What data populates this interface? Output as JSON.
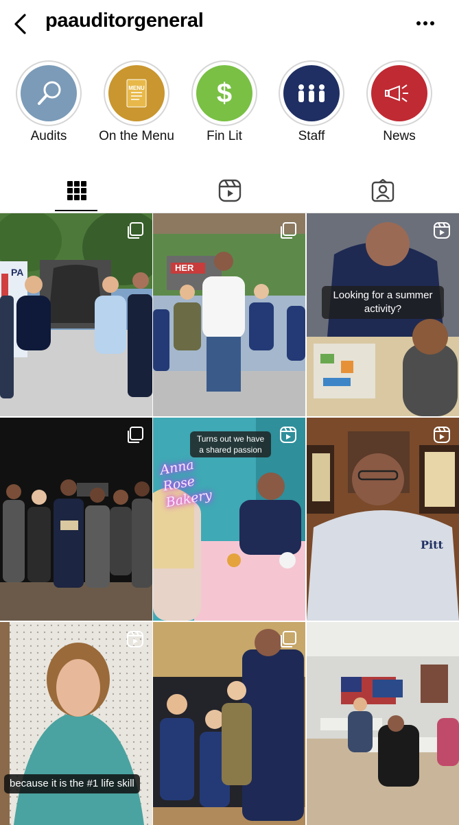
{
  "header": {
    "username": "paauditorgeneral",
    "back_icon": "chevron-left-icon",
    "more_icon": "more-horizontal-icon"
  },
  "highlights": [
    {
      "label": "Audits",
      "color": "#7b9bb8",
      "icon": "magnifier-icon"
    },
    {
      "label": "On the Menu",
      "color": "#c9962f",
      "icon": "menu-card-icon",
      "icon_text": "MENU"
    },
    {
      "label": "Fin Lit",
      "color": "#79c044",
      "icon": "dollar-icon",
      "icon_text": "$"
    },
    {
      "label": "Staff",
      "color": "#1f2f63",
      "icon": "people-icon"
    },
    {
      "label": "News",
      "color": "#c02a33",
      "icon": "megaphone-icon"
    }
  ],
  "tabs": [
    {
      "name": "posts",
      "icon": "grid-icon",
      "active": true
    },
    {
      "name": "reels",
      "icon": "reels-icon",
      "active": false
    },
    {
      "name": "tagged",
      "icon": "tagged-person-icon",
      "active": false
    }
  ],
  "posts": [
    {
      "type": "carousel",
      "scene": "Event at Liberty Bell replica with five people",
      "sign_text": "PA"
    },
    {
      "type": "carousel",
      "scene": "Scouts with man in white polo at shelter",
      "sign_text": "HER"
    },
    {
      "type": "reel",
      "caption": "Looking for a summer activity?",
      "scene": "Man with child doing stickers"
    },
    {
      "type": "carousel",
      "scene": "Group holding award on stage"
    },
    {
      "type": "reel",
      "caption": "Turns out we have a shared passion",
      "neon_text": "Anna Rose Bakery",
      "scene": "Man talking with woman in bakery"
    },
    {
      "type": "reel",
      "scene": "Man in checked shirt",
      "shirt_text": "Pitt"
    },
    {
      "type": "reel",
      "caption": "because it is the #1 life skill",
      "scene": "Woman talking to camera"
    },
    {
      "type": "carousel",
      "scene": "Man in suit with three cub scouts"
    },
    {
      "type": "reel",
      "scene": "Classroom with students"
    }
  ],
  "colors": {
    "ring": "#d6d6d6",
    "caption_bg": "rgba(30,30,30,0.82)"
  }
}
